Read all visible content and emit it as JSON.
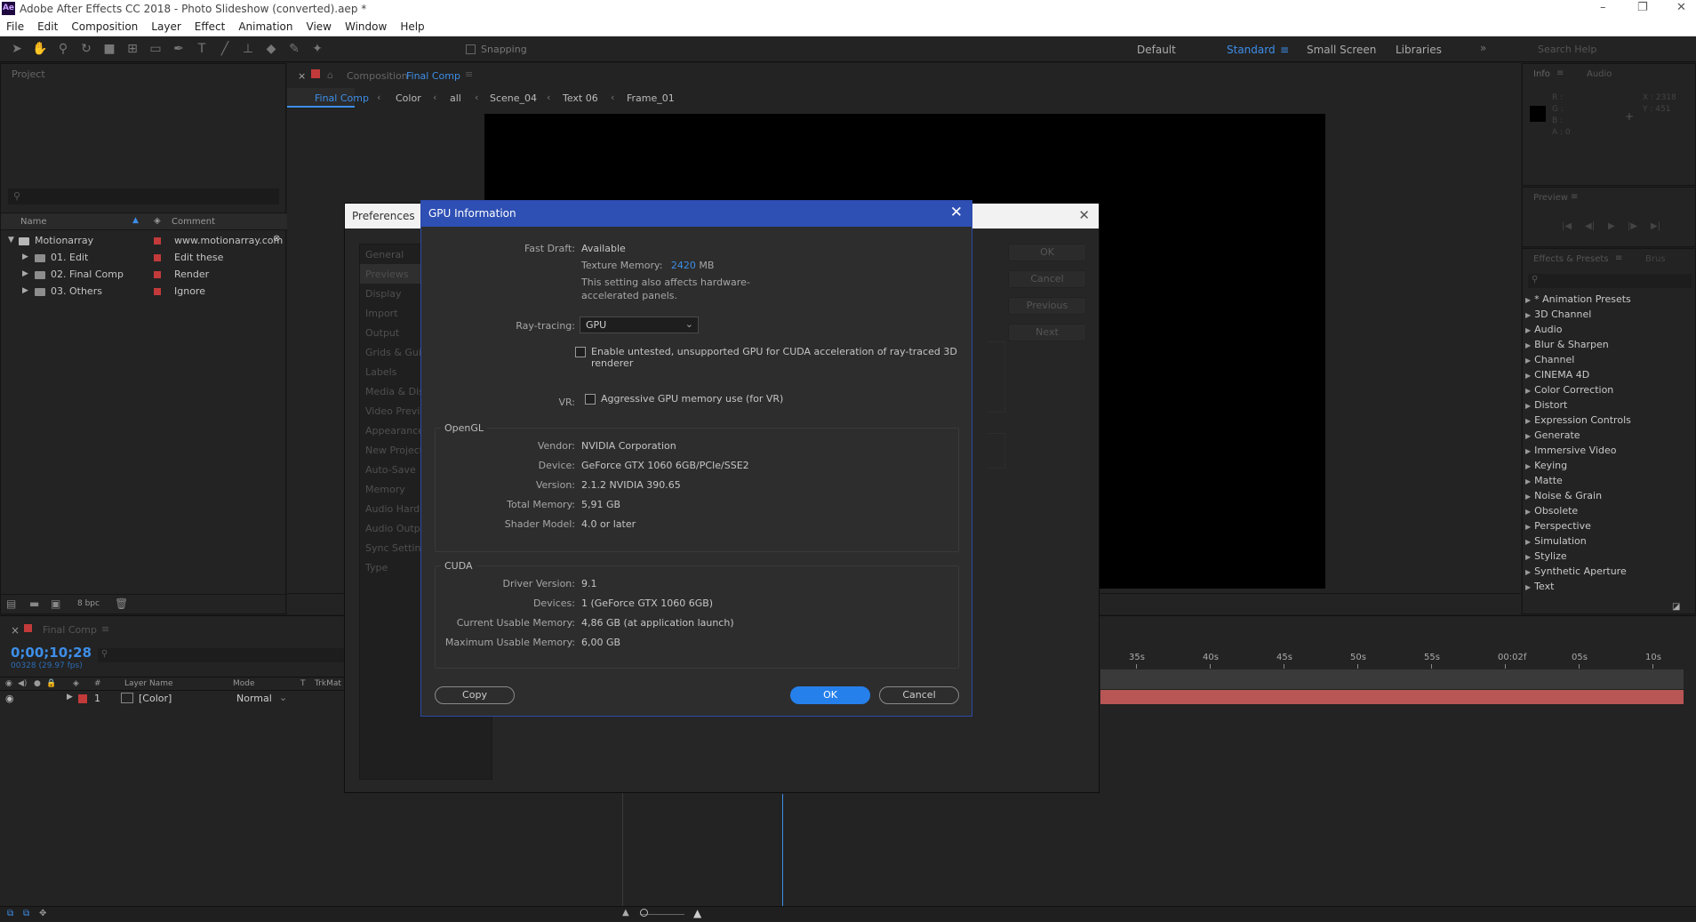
{
  "app": {
    "title": "Adobe After Effects CC 2018 - Photo Slideshow (converted).aep *",
    "logo": "Ae",
    "controls": {
      "minimize": "–",
      "maximize": "❐",
      "close": "✕"
    }
  },
  "menu": [
    "File",
    "Edit",
    "Composition",
    "Layer",
    "Effect",
    "Animation",
    "View",
    "Window",
    "Help"
  ],
  "toolbar": {
    "snapping": "Snapping",
    "workspaces": [
      "Default",
      "Standard",
      "Small Screen",
      "Libraries"
    ],
    "active_workspace": "Standard",
    "search_placeholder": "Search Help"
  },
  "project": {
    "title": "Project",
    "columns": {
      "name": "Name",
      "comment": "Comment"
    },
    "items": [
      {
        "name": "Motionarray",
        "comment": "www.motionarray.com"
      },
      {
        "name": "01. Edit",
        "comment": "Edit these"
      },
      {
        "name": "02. Final Comp",
        "comment": "Render"
      },
      {
        "name": "03. Others",
        "comment": "Ignore"
      }
    ],
    "bpc": "8 bpc"
  },
  "composition": {
    "tab_prefix": "Composition",
    "tab_name": "Final Comp",
    "breadcrumbs": [
      "Final Comp",
      "Color",
      "all",
      "Scene_04",
      "Text 06",
      "Frame_01"
    ]
  },
  "info": {
    "tab": "Info",
    "tab2": "Audio",
    "r": "R :",
    "g": "G :",
    "b": "B :",
    "a": "A : 0",
    "x": "X : 2318",
    "y": "Y : 451"
  },
  "preview": {
    "title": "Preview"
  },
  "effects": {
    "tab": "Effects & Presets",
    "tab2": "Brus",
    "items": [
      "* Animation Presets",
      "3D Channel",
      "Audio",
      "Blur & Sharpen",
      "Channel",
      "CINEMA 4D",
      "Color Correction",
      "Distort",
      "Expression Controls",
      "Generate",
      "Immersive Video",
      "Keying",
      "Matte",
      "Noise & Grain",
      "Obsolete",
      "Perspective",
      "Simulation",
      "Stylize",
      "Synthetic Aperture",
      "Text"
    ]
  },
  "timeline": {
    "tab": "Final Comp",
    "timecode": "0;00;10;28",
    "frames": "00328 (29.97 fps)",
    "headers": {
      "num": "#",
      "layer": "Layer Name",
      "mode": "Mode",
      "t": "T",
      "trkmat": "TrkMat"
    },
    "layer": {
      "num": "1",
      "name": "[Color]",
      "mode": "Normal"
    },
    "ruler": [
      "35s",
      "40s",
      "45s",
      "50s",
      "55s",
      "00:02f",
      "05s",
      "10s"
    ]
  },
  "preferences": {
    "title": "Preferences",
    "categories": [
      "General",
      "Previews",
      "Display",
      "Import",
      "Output",
      "Grids & Guides",
      "Labels",
      "Media & Disk Cache",
      "Video Preview",
      "Appearance",
      "New Project",
      "Auto-Save",
      "Memory",
      "Audio Hardware",
      "Audio Output Mapping",
      "Sync Settings",
      "Type"
    ],
    "buttons": [
      "OK",
      "Cancel",
      "Previous",
      "Next"
    ]
  },
  "gpu_dialog": {
    "title": "GPU Information",
    "fast_draft_label": "Fast Draft:",
    "fast_draft_value": "Available",
    "texture_memory_label": "Texture Memory:",
    "texture_memory_value": "2420",
    "texture_memory_unit": "MB",
    "texture_note": "This setting also affects hardware-accelerated panels.",
    "raytracing_label": "Ray-tracing:",
    "raytracing_value": "GPU",
    "cuda_checkbox": "Enable untested, unsupported GPU for CUDA acceleration of ray-traced 3D renderer",
    "vr_label": "VR:",
    "vr_checkbox": "Aggressive GPU memory use (for VR)",
    "opengl": {
      "title": "OpenGL",
      "rows": [
        {
          "label": "Vendor:",
          "value": "NVIDIA Corporation"
        },
        {
          "label": "Device:",
          "value": "GeForce GTX 1060 6GB/PCIe/SSE2"
        },
        {
          "label": "Version:",
          "value": "2.1.2 NVIDIA 390.65"
        },
        {
          "label": "Total Memory:",
          "value": "5,91 GB"
        },
        {
          "label": "Shader Model:",
          "value": "4.0 or later"
        }
      ]
    },
    "cuda": {
      "title": "CUDA",
      "rows": [
        {
          "label": "Driver Version:",
          "value": "9.1"
        },
        {
          "label": "Devices:",
          "value": "1 (GeForce GTX 1060 6GB)"
        },
        {
          "label": "Current Usable Memory:",
          "value": "4,86 GB (at application launch)"
        },
        {
          "label": "Maximum Usable Memory:",
          "value": "6,00 GB"
        }
      ]
    },
    "buttons": {
      "copy": "Copy",
      "ok": "OK",
      "cancel": "Cancel"
    }
  }
}
